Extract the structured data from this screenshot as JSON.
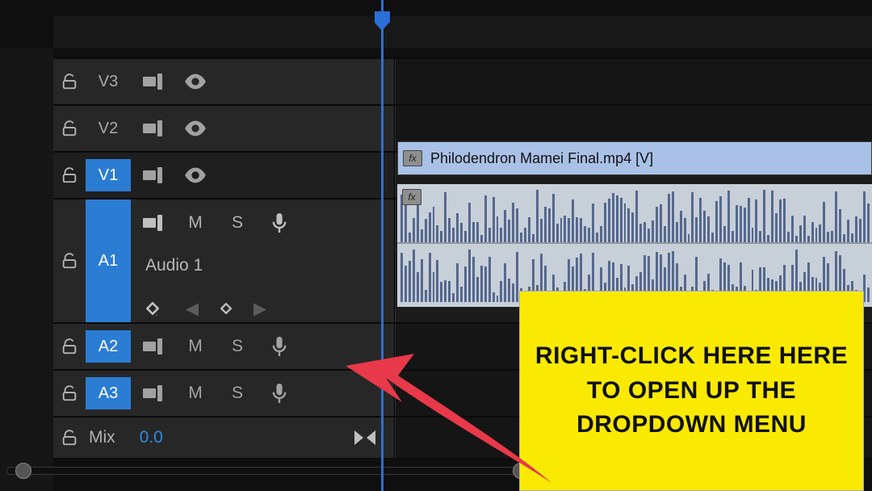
{
  "tracks": {
    "v3": {
      "label": "V3"
    },
    "v2": {
      "label": "V2"
    },
    "v1": {
      "label": "V1"
    },
    "a1": {
      "label": "A1",
      "name": "Audio 1"
    },
    "a2": {
      "label": "A2"
    },
    "a3": {
      "label": "A3"
    },
    "mix": {
      "label": "Mix",
      "value": "0.0"
    }
  },
  "buttons": {
    "mute": "M",
    "solo": "S"
  },
  "clip": {
    "video_name": "Philodendron Mamei Final.mp4 [V]",
    "fx": "fx"
  },
  "annotation": {
    "text": "RIGHT-CLICK HERE HERE TO OPEN UP THE DROPDOWN MENU"
  }
}
